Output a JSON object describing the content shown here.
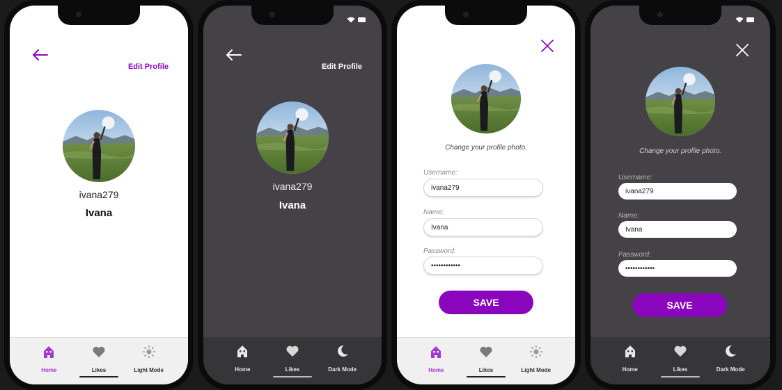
{
  "colors": {
    "accent": "#8a06bd",
    "dark_bg": "#444246",
    "dark_nav": "#363537",
    "light_bg": "#ffffff",
    "light_nav": "#f0f0f0"
  },
  "screens": [
    {
      "theme": "light",
      "header": {
        "back_icon": "arrow-left-icon",
        "edit_label": "Edit Profile"
      },
      "profile": {
        "avatar": "profile-photo",
        "username": "ivana279",
        "name": "Ivana"
      },
      "nav": {
        "items": [
          {
            "label": "Home",
            "icon": "home-icon",
            "active": true
          },
          {
            "label": "Likes",
            "icon": "heart-icon",
            "active": false
          },
          {
            "label": "Light Mode",
            "icon": "sun-icon",
            "active": false
          }
        ]
      }
    },
    {
      "theme": "dark",
      "header": {
        "back_icon": "arrow-left-icon",
        "edit_label": "Edit Profile"
      },
      "profile": {
        "avatar": "profile-photo",
        "username": "ivana279",
        "name": "Ivana"
      },
      "nav": {
        "items": [
          {
            "label": "Home",
            "icon": "home-icon",
            "active": false
          },
          {
            "label": "Likes",
            "icon": "heart-icon",
            "active": false
          },
          {
            "label": "Dark Mode",
            "icon": "moon-icon",
            "active": false
          }
        ]
      }
    },
    {
      "theme": "light",
      "header": {
        "close_icon": "close-icon"
      },
      "edit": {
        "change_photo": "Change your profile photo.",
        "username_label": "Username:",
        "username_value": "ivana279",
        "name_label": "Name:",
        "name_value": "Ivana",
        "password_label": "Password:",
        "password_value": "••••••••••••",
        "save_label": "SAVE"
      },
      "nav": {
        "items": [
          {
            "label": "Home",
            "icon": "home-icon",
            "active": true
          },
          {
            "label": "Likes",
            "icon": "heart-icon",
            "active": false
          },
          {
            "label": "Light Mode",
            "icon": "sun-icon",
            "active": false
          }
        ]
      }
    },
    {
      "theme": "dark",
      "header": {
        "close_icon": "close-icon"
      },
      "edit": {
        "change_photo": "Change your profile photo.",
        "username_label": "Username:",
        "username_value": "ivana279",
        "name_label": "Name:",
        "name_value": "Ivana",
        "password_label": "Password:",
        "password_value": "••••••••••••",
        "save_label": "SAVE"
      },
      "nav": {
        "items": [
          {
            "label": "Home",
            "icon": "home-icon",
            "active": false
          },
          {
            "label": "Likes",
            "icon": "heart-icon",
            "active": false
          },
          {
            "label": "Dark Mode",
            "icon": "moon-icon",
            "active": false
          }
        ]
      }
    }
  ]
}
